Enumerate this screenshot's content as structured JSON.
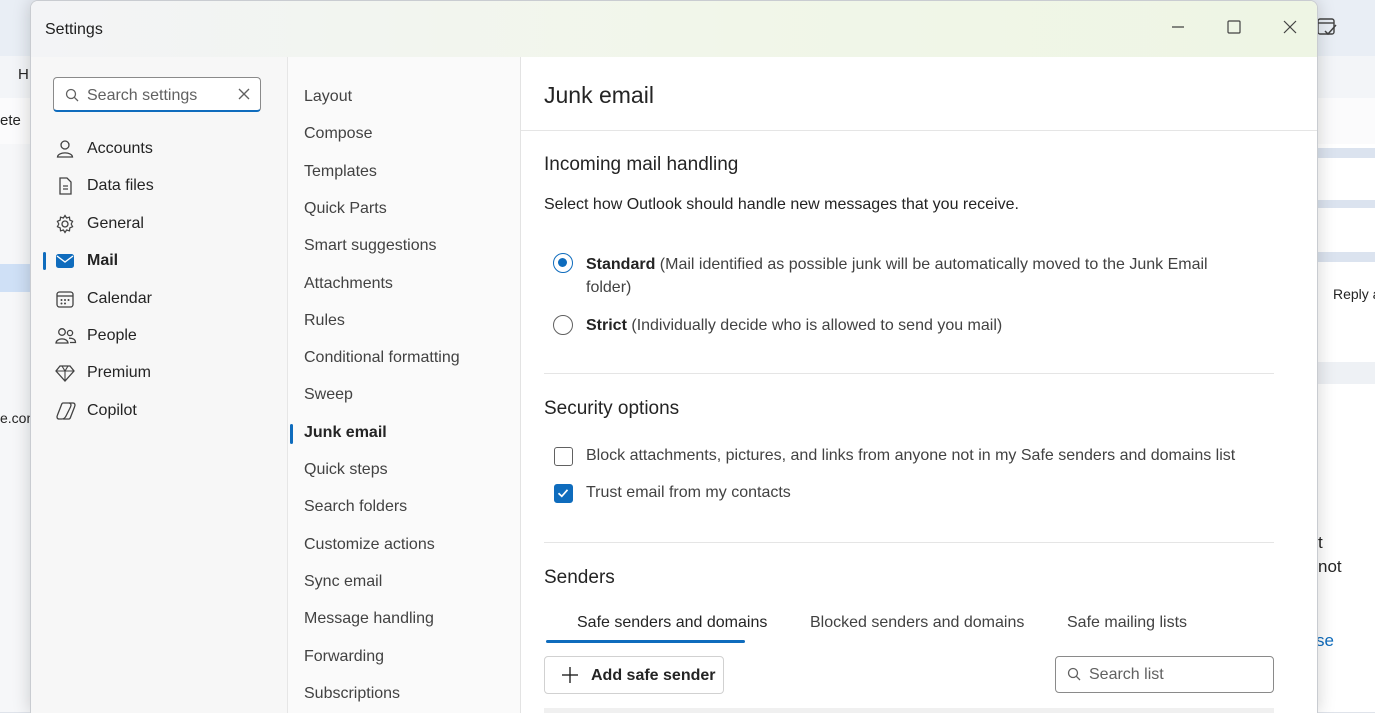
{
  "background": {
    "ribbon_tab_partial": "H",
    "delete_partial": "ete",
    "email_partial": "e.com",
    "reply_partial": "Reply a",
    "right_text_1": "t",
    "right_text_2": "not",
    "right_link_partial": "se"
  },
  "dialog": {
    "title": "Settings",
    "search_placeholder": "Search settings"
  },
  "categories": [
    {
      "label": "Accounts",
      "icon": "person-icon",
      "active": false
    },
    {
      "label": "Data files",
      "icon": "document-icon",
      "active": false
    },
    {
      "label": "General",
      "icon": "gear-icon",
      "active": false
    },
    {
      "label": "Mail",
      "icon": "mail-icon",
      "active": true
    },
    {
      "label": "Calendar",
      "icon": "calendar-icon",
      "active": false
    },
    {
      "label": "People",
      "icon": "people-icon",
      "active": false
    },
    {
      "label": "Premium",
      "icon": "diamond-icon",
      "active": false
    },
    {
      "label": "Copilot",
      "icon": "copilot-icon",
      "active": false
    }
  ],
  "mail_sections": [
    {
      "label": "Layout"
    },
    {
      "label": "Compose"
    },
    {
      "label": "Templates"
    },
    {
      "label": "Quick Parts"
    },
    {
      "label": "Smart suggestions"
    },
    {
      "label": "Attachments"
    },
    {
      "label": "Rules"
    },
    {
      "label": "Conditional formatting"
    },
    {
      "label": "Sweep"
    },
    {
      "label": "Junk email"
    },
    {
      "label": "Quick steps"
    },
    {
      "label": "Search folders"
    },
    {
      "label": "Customize actions"
    },
    {
      "label": "Sync email"
    },
    {
      "label": "Message handling"
    },
    {
      "label": "Forwarding"
    },
    {
      "label": "Subscriptions"
    }
  ],
  "active_section": "Junk email",
  "content": {
    "page_title": "Junk email",
    "incoming": {
      "title": "Incoming mail handling",
      "description": "Select how Outlook should handle new messages that you receive.",
      "standard_label": "Standard",
      "standard_desc": "(Mail identified as possible junk will be automatically moved to the Junk Email folder)",
      "strict_label": "Strict",
      "strict_desc": "(Individually decide who is allowed to send you mail)",
      "selected": "Standard"
    },
    "security": {
      "title": "Security options",
      "block_label": "Block attachments, pictures, and links from anyone not in my Safe senders and domains list",
      "block_checked": false,
      "trust_label": "Trust email from my contacts",
      "trust_checked": true
    },
    "senders": {
      "title": "Senders",
      "tabs": [
        "Safe senders and domains",
        "Blocked senders and domains",
        "Safe mailing lists"
      ],
      "active_tab": "Safe senders and domains",
      "add_button": "Add safe sender",
      "search_placeholder": "Search list"
    }
  },
  "colors": {
    "accent": "#0f6cbd"
  }
}
